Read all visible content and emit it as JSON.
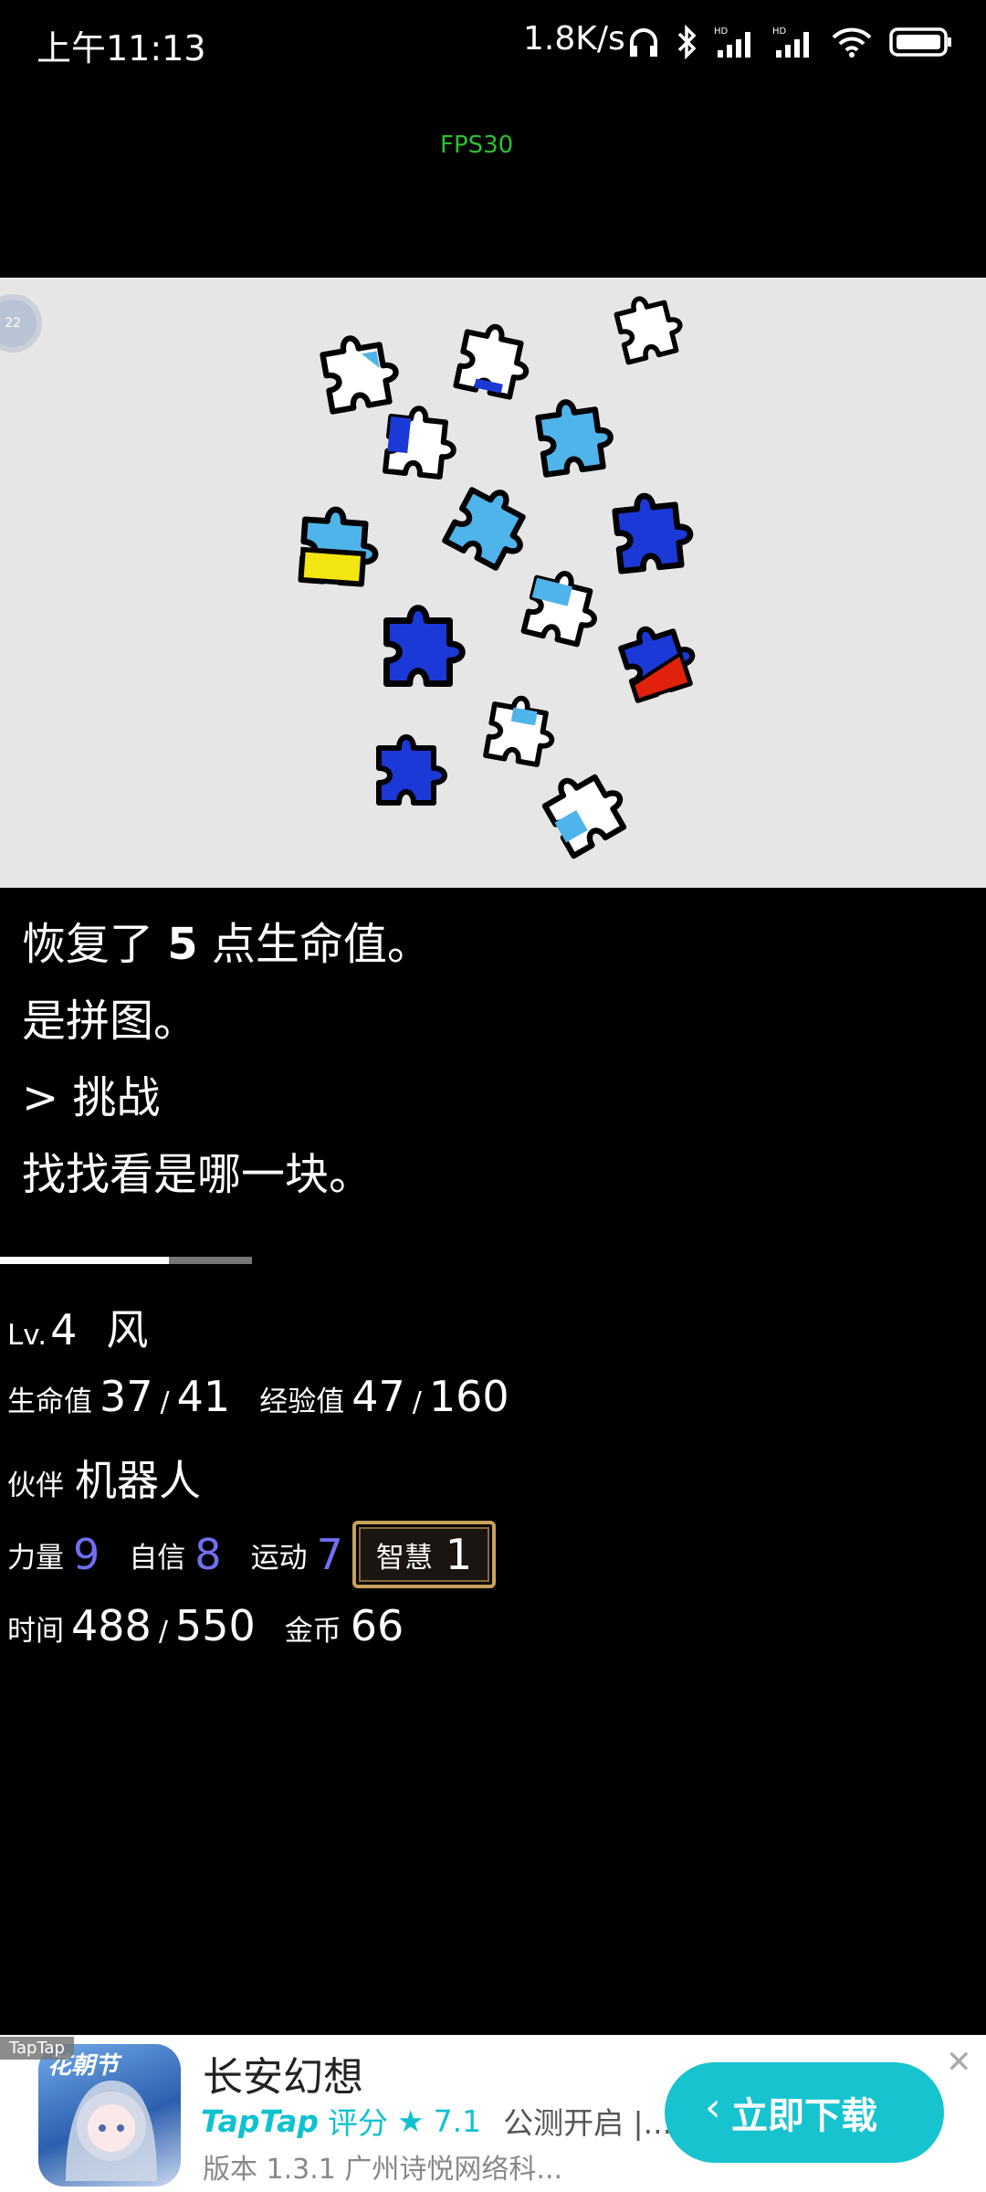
{
  "status_bar": {
    "time": "上午11:13",
    "net_speed": "1.8K/s"
  },
  "fps": "FPS30",
  "overlay_badge": "22",
  "log": {
    "line1_pre": "恢复了 ",
    "line1_num": "5",
    "line1_post": " 点生命值。",
    "line2": "是拼图。",
    "line3": "> 挑战",
    "line4": "找找看是哪一块。"
  },
  "hp_fraction": 0.672,
  "stats": {
    "lv_label": "Lv.",
    "lv": "4",
    "name": "风",
    "hp_label": "生命值",
    "hp": "37",
    "hp_max": "41",
    "exp_label": "经验值",
    "exp": "47",
    "exp_max": "160",
    "partner_label": "伙伴",
    "partner": "机器人",
    "str_label": "力量",
    "str": "9",
    "conf_label": "自信",
    "conf": "8",
    "sport_label": "运动",
    "sport": "7",
    "wis_label": "智慧",
    "wis": "1",
    "time_label": "时间",
    "time": "488",
    "time_max": "550",
    "gold_label": "金币",
    "gold": "66",
    "slash": "/"
  },
  "ad": {
    "tag": "TapTap",
    "title": "长安幻想",
    "brand": "TapTap",
    "rating_label": "评分",
    "rating": "7.1",
    "desc": "公测开启 |...",
    "meta": "版本 1.3.1  广州诗悦网络科...",
    "button": "立即下载"
  },
  "colors": {
    "stat_blue": "#6f6ff0",
    "fps_green": "#29c22e",
    "ad_button": "#16c3cf"
  }
}
